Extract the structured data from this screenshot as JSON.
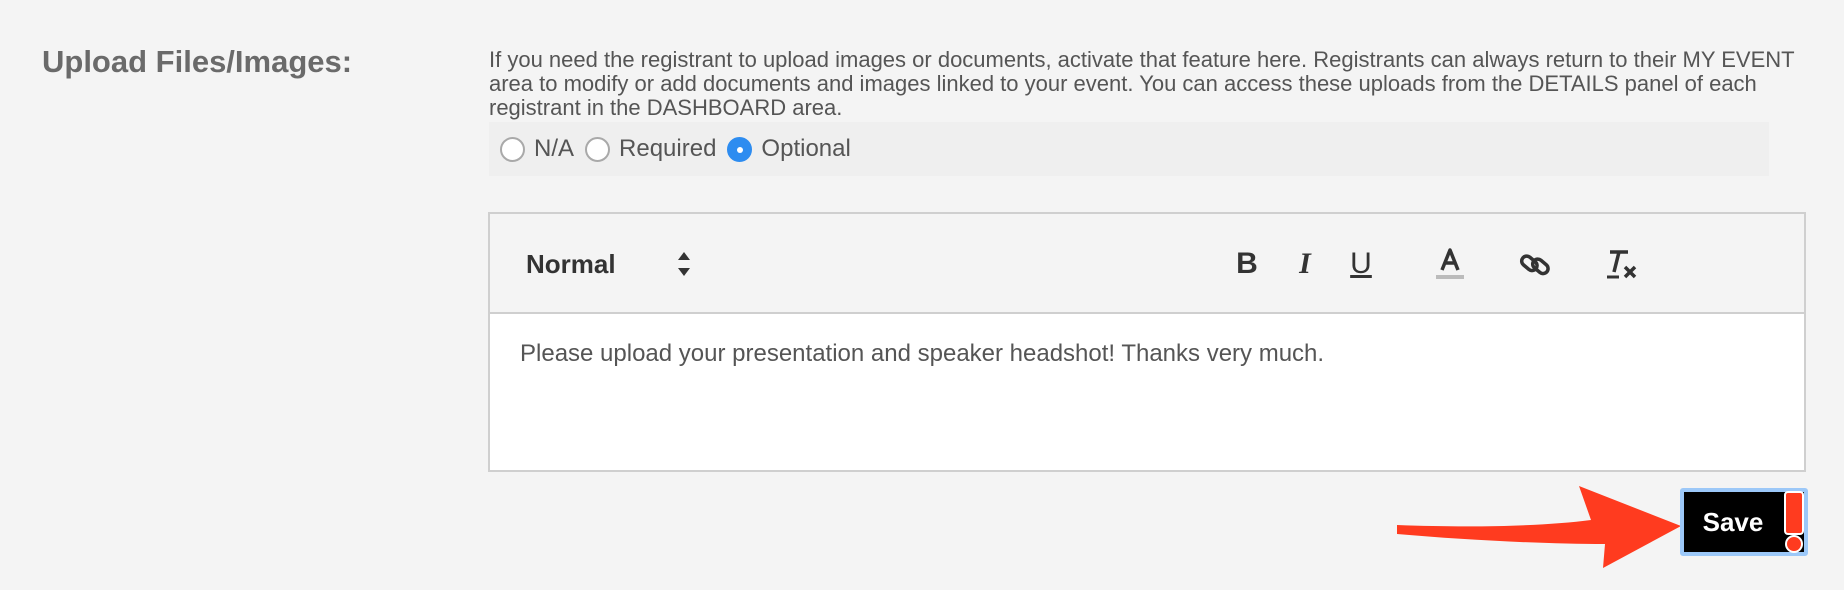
{
  "section": {
    "label": "Upload Files/Images:",
    "help_text": "If you need the registrant to upload images or documents, activate that feature here. Registrants can always return to their MY EVENT area to modify or add documents and images linked to your event. You can access these uploads from the DETAILS panel of each registrant in the DASHBOARD area."
  },
  "radio_options": [
    {
      "label": "N/A",
      "checked": false
    },
    {
      "label": "Required",
      "checked": false
    },
    {
      "label": "Optional",
      "checked": true
    }
  ],
  "editor": {
    "format_select": "Normal",
    "bold_label": "B",
    "italic_label": "I",
    "underline_label": "U",
    "body_text": "Please upload your presentation and speaker headshot! Thanks very much."
  },
  "save_button": {
    "label": "Save"
  },
  "colors": {
    "accent": "#2d8cf0",
    "annotation": "#ff3b1f"
  }
}
